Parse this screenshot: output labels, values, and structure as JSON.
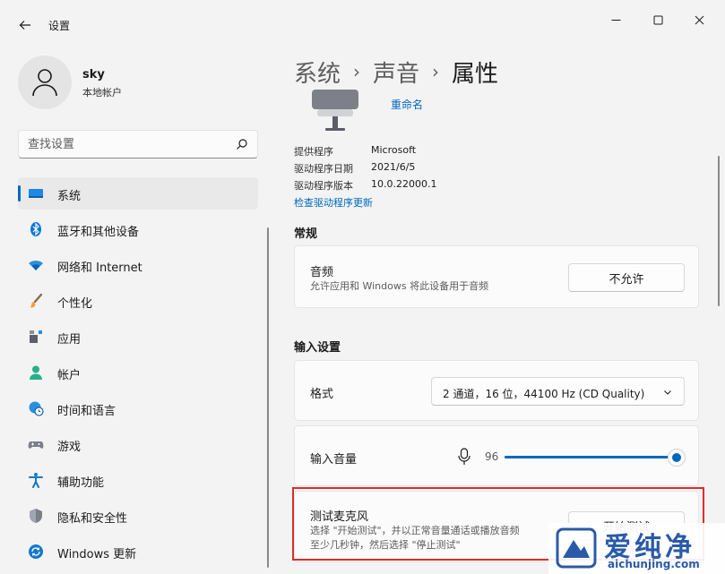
{
  "window": {
    "title": "设置",
    "minimize_icon": "minimize-icon",
    "maximize_icon": "maximize-icon",
    "close_icon": "close-icon"
  },
  "user": {
    "name": "sky",
    "account_type": "本地帐户"
  },
  "search": {
    "placeholder": "查找设置"
  },
  "sidebar": {
    "items": [
      {
        "label": "系统",
        "icon": "system-icon",
        "active": true
      },
      {
        "label": "蓝牙和其他设备",
        "icon": "bluetooth-icon"
      },
      {
        "label": "网络和 Internet",
        "icon": "wifi-icon"
      },
      {
        "label": "个性化",
        "icon": "brush-icon"
      },
      {
        "label": "应用",
        "icon": "apps-icon"
      },
      {
        "label": "帐户",
        "icon": "account-icon"
      },
      {
        "label": "时间和语言",
        "icon": "globe-clock-icon"
      },
      {
        "label": "游戏",
        "icon": "gamepad-icon"
      },
      {
        "label": "辅助功能",
        "icon": "accessibility-icon"
      },
      {
        "label": "隐私和安全性",
        "icon": "shield-icon"
      },
      {
        "label": "Windows 更新",
        "icon": "update-icon"
      }
    ]
  },
  "breadcrumb": {
    "items": [
      "系统",
      "声音",
      "属性"
    ],
    "separator": "›"
  },
  "device": {
    "rename_label": "重命名",
    "info": [
      {
        "key": "提供程序",
        "value": "Microsoft"
      },
      {
        "key": "驱动程序日期",
        "value": "2021/6/5"
      },
      {
        "key": "驱动程序版本",
        "value": "10.0.22000.1"
      }
    ],
    "check_driver_link": "检查驱动程序更新"
  },
  "general": {
    "section_title": "常规",
    "audio": {
      "title": "音频",
      "description": "允许应用和 Windows 将此设备用于音频",
      "button_label": "不允许"
    }
  },
  "input_settings": {
    "section_title": "输入设置",
    "format": {
      "title": "格式",
      "selected": "2 通道，16 位，44100 Hz (CD Quality)"
    },
    "volume": {
      "title": "输入音量",
      "value": "96",
      "level": 0.96
    },
    "test_mic": {
      "title": "测试麦克风",
      "description_line1": "选择 \"开始测试\"，并以正常音量通话或播放音频",
      "description_line2": "至少几秒钟，然后选择 \"停止测试\"",
      "button_label": "开始测试"
    }
  },
  "watermark": {
    "brand_cn": "爱纯净",
    "brand_en": "aichunjing.com"
  },
  "colors": {
    "accent": "#0067c0",
    "highlight": "#e12b2b",
    "watermark": "#2a5aa8"
  }
}
